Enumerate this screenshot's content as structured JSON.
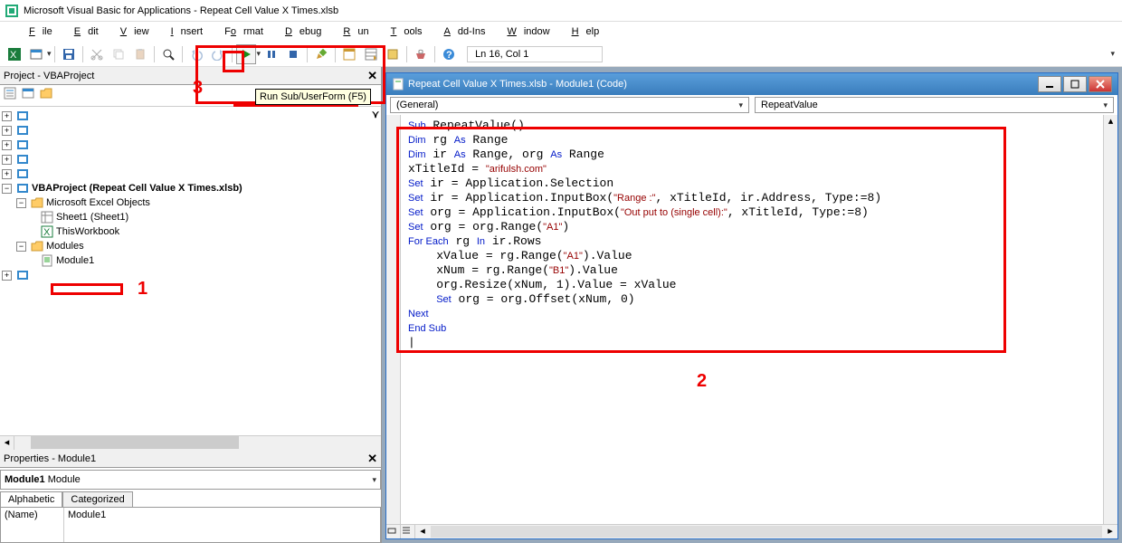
{
  "app": {
    "title": "Microsoft Visual Basic for Applications - Repeat Cell Value X Times.xlsb"
  },
  "menu": {
    "file": "File",
    "edit": "Edit",
    "view": "View",
    "insert": "Insert",
    "format": "Format",
    "debug": "Debug",
    "run": "Run",
    "tools": "Tools",
    "addins": "Add-Ins",
    "window": "Window",
    "help": "Help"
  },
  "toolbar": {
    "status": "Ln 16, Col 1",
    "tooltip": "Run Sub/UserForm (F5)"
  },
  "project": {
    "title": "Project - VBAProject",
    "root": "VBAProject (Repeat Cell Value X Times.xlsb)",
    "objfolder": "Microsoft Excel Objects",
    "sheet": "Sheet1 (Sheet1)",
    "thiswb": "ThisWorkbook",
    "modules": "Modules",
    "module1": "Module1"
  },
  "properties": {
    "title": "Properties - Module1",
    "selected": "Module1",
    "selected_type": "Module",
    "tab_alpha": "Alphabetic",
    "tab_cat": "Categorized",
    "prop_name": "(Name)",
    "prop_val": "Module1"
  },
  "code": {
    "title": "Repeat Cell Value X Times.xlsb - Module1 (Code)",
    "dd_left": "(General)",
    "dd_right": "RepeatValue",
    "lines": [
      {
        "t": "kw",
        "v": "Sub"
      },
      {
        "t": "p",
        "v": " RepeatValue()"
      },
      {
        "t": "nl"
      },
      {
        "t": "kw",
        "v": "Dim"
      },
      {
        "t": "p",
        "v": " rg "
      },
      {
        "t": "kw",
        "v": "As"
      },
      {
        "t": "p",
        "v": " Range"
      },
      {
        "t": "nl"
      },
      {
        "t": "kw",
        "v": "Dim"
      },
      {
        "t": "p",
        "v": " ir "
      },
      {
        "t": "kw",
        "v": "As"
      },
      {
        "t": "p",
        "v": " Range, org "
      },
      {
        "t": "kw",
        "v": "As"
      },
      {
        "t": "p",
        "v": " Range"
      },
      {
        "t": "nl"
      },
      {
        "t": "p",
        "v": "xTitleId = "
      },
      {
        "t": "str",
        "v": "\"arifulsh.com\""
      },
      {
        "t": "nl"
      },
      {
        "t": "kw",
        "v": "Set"
      },
      {
        "t": "p",
        "v": " ir = Application.Selection"
      },
      {
        "t": "nl"
      },
      {
        "t": "kw",
        "v": "Set"
      },
      {
        "t": "p",
        "v": " ir = Application.InputBox("
      },
      {
        "t": "str",
        "v": "\"Range :\""
      },
      {
        "t": "p",
        "v": ", xTitleId, ir.Address, Type:=8)"
      },
      {
        "t": "nl"
      },
      {
        "t": "kw",
        "v": "Set"
      },
      {
        "t": "p",
        "v": " org = Application.InputBox("
      },
      {
        "t": "str",
        "v": "\"Out put to (single cell):\""
      },
      {
        "t": "p",
        "v": ", xTitleId, Type:=8)"
      },
      {
        "t": "nl"
      },
      {
        "t": "kw",
        "v": "Set"
      },
      {
        "t": "p",
        "v": " org = org.Range("
      },
      {
        "t": "str",
        "v": "\"A1\""
      },
      {
        "t": "p",
        "v": ")"
      },
      {
        "t": "nl"
      },
      {
        "t": "kw",
        "v": "For Each"
      },
      {
        "t": "p",
        "v": " rg "
      },
      {
        "t": "kw",
        "v": "In"
      },
      {
        "t": "p",
        "v": " ir.Rows"
      },
      {
        "t": "nl"
      },
      {
        "t": "p",
        "v": "    xValue = rg.Range("
      },
      {
        "t": "str",
        "v": "\"A1\""
      },
      {
        "t": "p",
        "v": ").Value"
      },
      {
        "t": "nl"
      },
      {
        "t": "p",
        "v": "    xNum = rg.Range("
      },
      {
        "t": "str",
        "v": "\"B1\""
      },
      {
        "t": "p",
        "v": ").Value"
      },
      {
        "t": "nl"
      },
      {
        "t": "p",
        "v": "    org.Resize(xNum, 1).Value = xValue"
      },
      {
        "t": "nl"
      },
      {
        "t": "p",
        "v": "    "
      },
      {
        "t": "kw",
        "v": "Set"
      },
      {
        "t": "p",
        "v": " org = org.Offset(xNum, 0)"
      },
      {
        "t": "nl"
      },
      {
        "t": "kw",
        "v": "Next"
      },
      {
        "t": "nl"
      },
      {
        "t": "kw",
        "v": "End Sub"
      },
      {
        "t": "nl"
      }
    ]
  },
  "annotations": {
    "a1": "1",
    "a2": "2",
    "a3": "3"
  }
}
